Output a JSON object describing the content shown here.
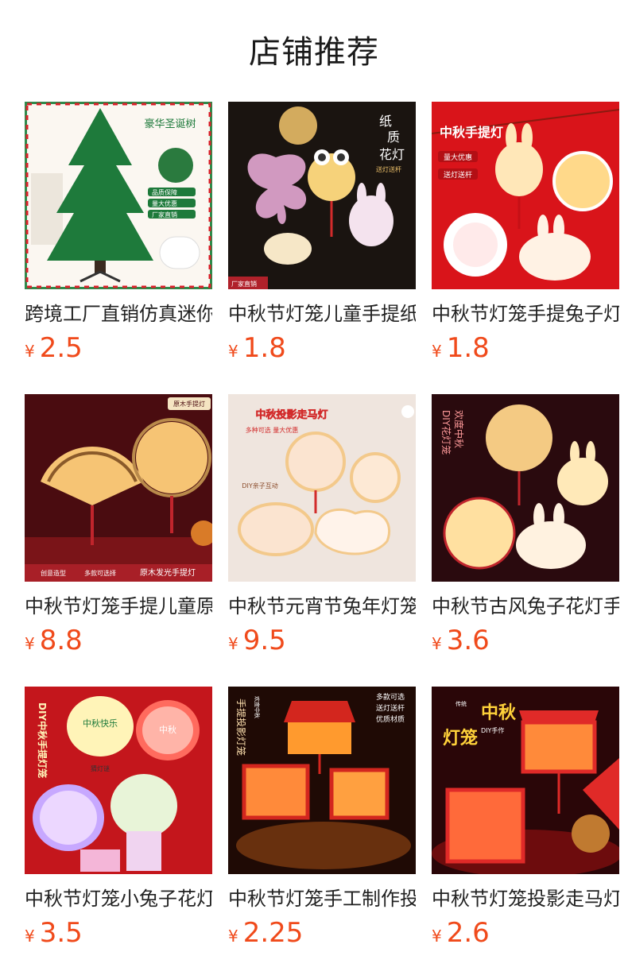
{
  "header": {
    "title": "店铺推荐"
  },
  "products": [
    {
      "name": "跨境工厂直销仿真迷你圣诞树",
      "currency": "¥",
      "price": "2.5",
      "image_text": [
        "豪华圣诞树",
        "品质保障",
        "量大优惠",
        "厂家直销"
      ],
      "image_icon": "christmas-tree-icon",
      "colors": {
        "bg": "#f7f4ef",
        "accent": "#1e7a3b",
        "frame": "#2f8a4b"
      }
    },
    {
      "name": "中秋节灯笼儿童手提纸质花灯",
      "currency": "¥",
      "price": "1.8",
      "image_text": [
        "纸",
        "质",
        "花灯",
        "送灯送杆",
        "厂家直销"
      ],
      "image_icon": "butterfly-lantern-icon",
      "colors": {
        "bg": "#1a1410",
        "accent": "#f4c66c",
        "frame": "#b98a4b"
      }
    },
    {
      "name": "中秋节灯笼手提兔子灯",
      "currency": "¥",
      "price": "1.8",
      "image_text": [
        "中秋手提灯",
        "量大优惠",
        "送灯送杆"
      ],
      "image_icon": "rabbit-lantern-icon",
      "colors": {
        "bg": "#d9141a",
        "accent": "#ffe7b8",
        "frame": "#ffffff"
      }
    },
    {
      "name": "中秋节灯笼手提儿童原木发光手提灯",
      "currency": "¥",
      "price": "8.8",
      "image_text": [
        "原木手提灯",
        "创意造型",
        "多款可选择",
        "原木发光手提灯"
      ],
      "image_icon": "fan-lantern-icon",
      "colors": {
        "bg": "#4a0c10",
        "accent": "#ffcf7a",
        "frame": "#8e1b1f"
      }
    },
    {
      "name": "中秋节元宵节兔年灯笼投影走马灯",
      "currency": "¥",
      "price": "9.5",
      "image_text": [
        "中秋投影走马灯",
        "多种可选 量大优惠",
        "DIY亲子互动"
      ],
      "image_icon": "projection-lantern-icon",
      "colors": {
        "bg": "#efe5de",
        "accent": "#d22b2b",
        "frame": "#f3c98b"
      }
    },
    {
      "name": "中秋节古风兔子花灯手提灯笼",
      "currency": "¥",
      "price": "3.6",
      "image_text": [
        "欢度中秋",
        "DIY花灯笼"
      ],
      "image_icon": "moon-rabbit-icon",
      "colors": {
        "bg": "#2a0a0e",
        "accent": "#ffd58a",
        "frame": "#c0252c"
      }
    },
    {
      "name": "中秋节灯笼小兔子花灯手提灯",
      "currency": "¥",
      "price": "3.5",
      "image_text": [
        "DIY中秋手提灯笼",
        "中秋快乐",
        "中秋",
        "猜灯谜"
      ],
      "image_icon": "paper-lantern-icon",
      "colors": {
        "bg": "#c4161c",
        "accent": "#ffe9a8",
        "frame": "#ffffff"
      }
    },
    {
      "name": "中秋节灯笼手工制作投影灯",
      "currency": "¥",
      "price": "2.25",
      "image_text": [
        "手提投影灯笼",
        "欢度中秋",
        "多款可选",
        "送灯送杆",
        "优质材质"
      ],
      "image_icon": "cube-lantern-icon",
      "colors": {
        "bg": "#1f0a05",
        "accent": "#ff9a2e",
        "frame": "#d3261e"
      }
    },
    {
      "name": "中秋节灯笼投影走马灯",
      "currency": "¥",
      "price": "2.6",
      "image_text": [
        "中秋",
        "灯笼",
        "DIY手作",
        "传统"
      ],
      "image_icon": "red-lantern-icon",
      "colors": {
        "bg": "#2a0608",
        "accent": "#ffd23a",
        "frame": "#e02a28"
      }
    }
  ]
}
